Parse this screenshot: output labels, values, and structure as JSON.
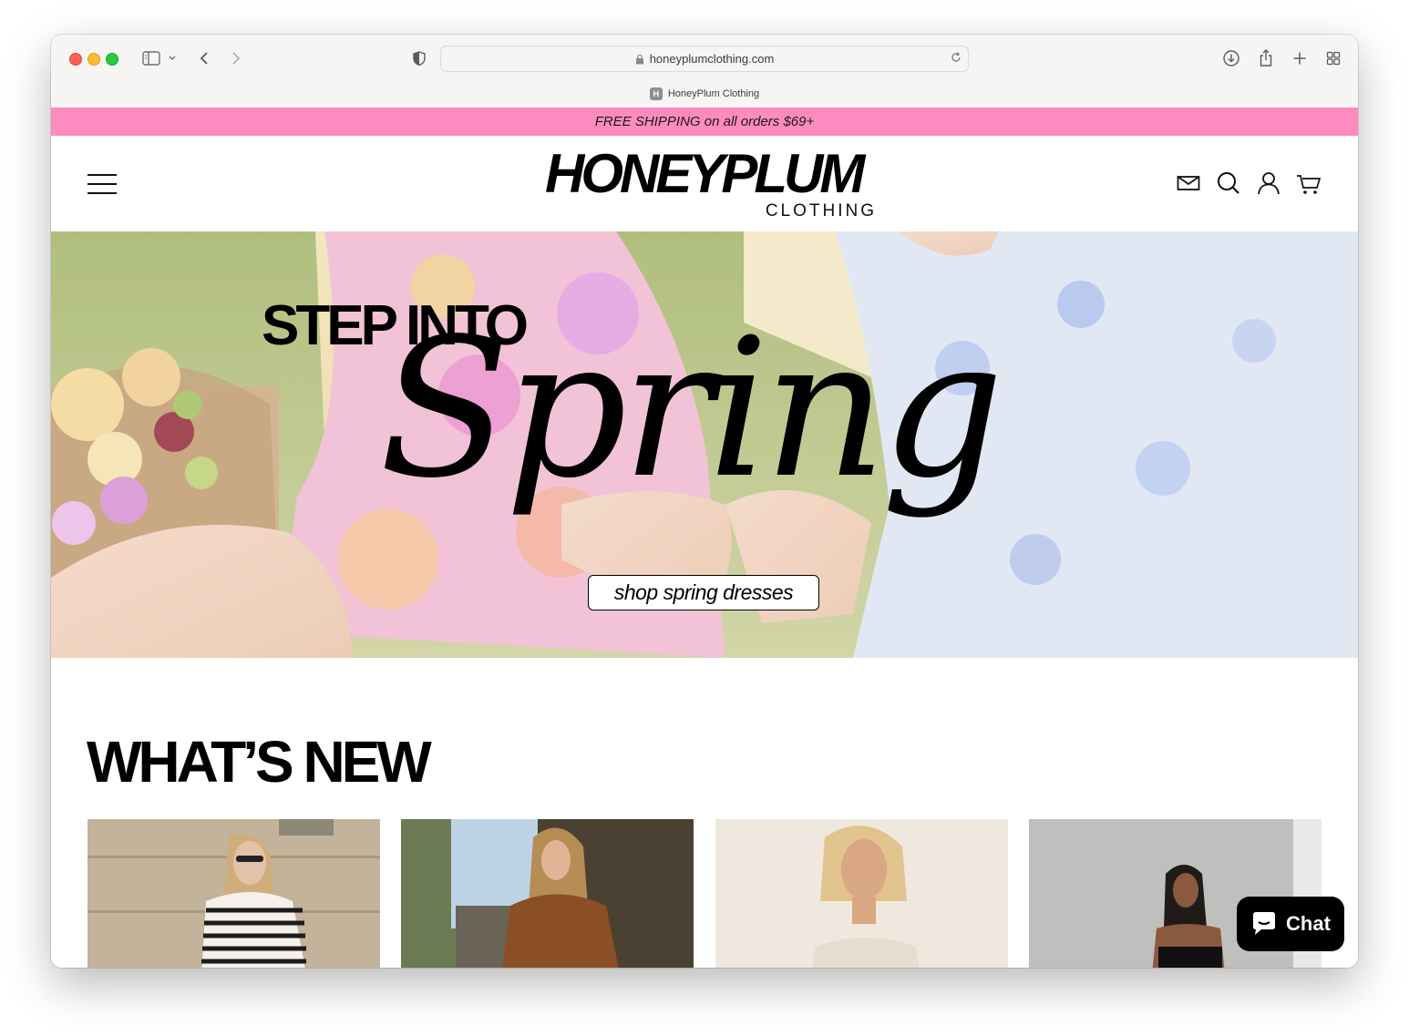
{
  "browser": {
    "url": "honeyplumclothing.com",
    "tab_title": "HoneyPlum Clothing",
    "favicon_letter": "H"
  },
  "announcement": "FREE SHIPPING on all orders $69+",
  "header": {
    "logo_main": "HONEYPLUM",
    "logo_sub": "CLOTHING",
    "icons": [
      "menu-icon",
      "mail-icon",
      "search-icon",
      "account-icon",
      "cart-icon"
    ]
  },
  "hero": {
    "headline": "STEP INTO",
    "script_word": "Spring",
    "cta": "shop spring dresses"
  },
  "whats_new": {
    "title": "WHAT’S NEW"
  },
  "chat": {
    "label": "Chat"
  },
  "colors": {
    "announcement_bg": "#fe8bbf",
    "text": "#000000",
    "chat_bg": "#000000"
  }
}
